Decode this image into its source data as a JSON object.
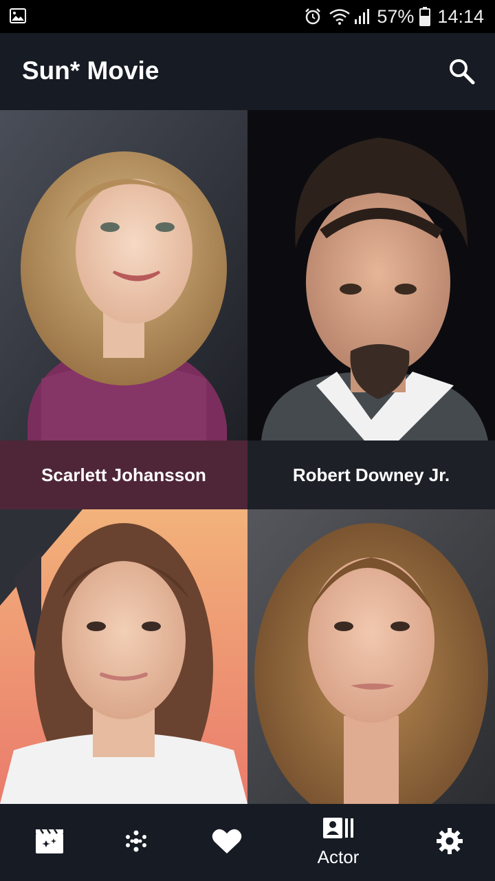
{
  "status_bar": {
    "battery": "57%",
    "time": "14:14",
    "icons": [
      "gallery-icon",
      "alarm-icon",
      "wifi-icon",
      "signal-icon",
      "battery-icon"
    ]
  },
  "app_bar": {
    "title": "Sun* Movie",
    "search_icon": "search-icon"
  },
  "actors": [
    {
      "name": "Scarlett Johansson",
      "caption_bg": "#4f2638"
    },
    {
      "name": "Robert Downey Jr.",
      "caption_bg": "#1d2027"
    },
    {
      "name": "",
      "caption_bg": ""
    },
    {
      "name": "",
      "caption_bg": ""
    }
  ],
  "bottom_nav": {
    "items": [
      {
        "icon": "movie-clapper-icon",
        "label": ""
      },
      {
        "icon": "genre-dots-icon",
        "label": ""
      },
      {
        "icon": "heart-icon",
        "label": ""
      },
      {
        "icon": "actor-card-icon",
        "label": "Actor",
        "active": true
      },
      {
        "icon": "settings-gear-icon",
        "label": ""
      }
    ]
  },
  "colors": {
    "background": "#161b24",
    "status_bar": "#000000",
    "text": "#ffffff"
  }
}
